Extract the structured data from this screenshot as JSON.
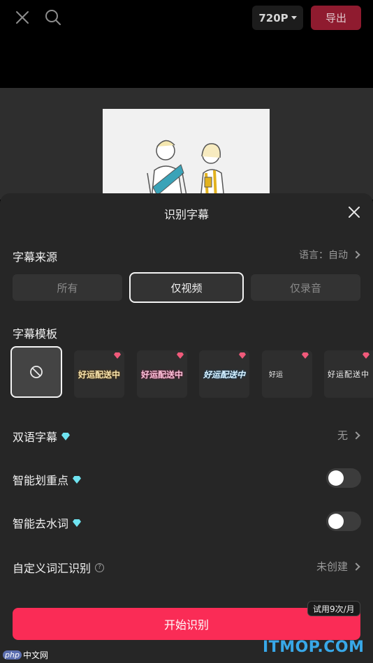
{
  "topbar": {
    "resolution": "720P",
    "export_label": "导出",
    "icons": [
      "close-icon",
      "search-icon",
      "chevron-down-icon"
    ]
  },
  "sheet": {
    "title": "识别字幕",
    "source": {
      "label": "字幕来源",
      "language_text": "语言：自动",
      "options": [
        "所有",
        "仅视频",
        "仅录音"
      ],
      "selected": "仅视频"
    },
    "template": {
      "label": "字幕模板",
      "items": [
        {
          "text": ""
        },
        {
          "text": "好运配送中"
        },
        {
          "text": "好运配送中"
        },
        {
          "text": "好运配送中"
        },
        {
          "text": "好运"
        },
        {
          "text": "好运配送中"
        }
      ]
    },
    "bilingual": {
      "label": "双语字幕",
      "value": "无"
    },
    "highlight": {
      "label": "智能划重点",
      "enabled": false
    },
    "filler": {
      "label": "智能去水词",
      "enabled": false
    },
    "custom_vocab": {
      "label": "自定义词汇识别",
      "value": "未创建"
    },
    "start_button": "开始识别",
    "trial_badge": "试用9次/月"
  },
  "watermarks": {
    "right": "ITMOP.COM",
    "left_php": "php",
    "left_cn": "中文网"
  },
  "colors": {
    "accent": "#fa2c56",
    "export_bg": "#8f1b2f",
    "sheet_bg": "#262626",
    "gem": "#6fe3f0"
  }
}
